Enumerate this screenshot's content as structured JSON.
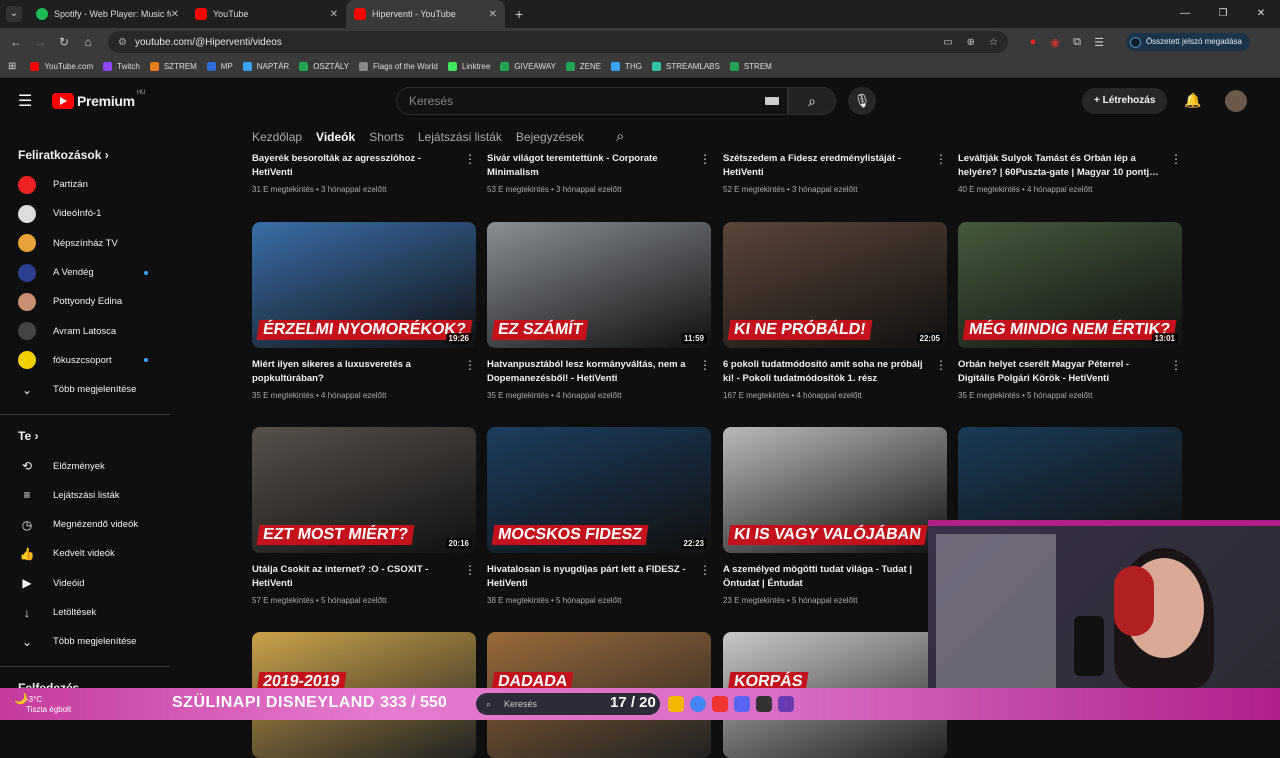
{
  "browser": {
    "tabs": [
      {
        "title": "Spotify - Web Player: Music for",
        "color": "#1db954"
      },
      {
        "title": "YouTube",
        "color": "#ff0000"
      },
      {
        "title": "Hiperventi - YouTube",
        "color": "#ff0000"
      }
    ],
    "url": "youtube.com/@Hiperventi/videos",
    "profile_label": "Összetett jelszó megadása",
    "bookmarks": [
      {
        "label": "YouTube.com",
        "color": "#ff0000"
      },
      {
        "label": "Twitch",
        "color": "#9146ff"
      },
      {
        "label": "SZTREM",
        "color": "#e87a1f"
      },
      {
        "label": "MP",
        "color": "#2e6bd8"
      },
      {
        "label": "NAPTÁR",
        "color": "#3aa4ff"
      },
      {
        "label": "OSZTÁLY",
        "color": "#23a455"
      },
      {
        "label": "Flags of the World",
        "color": "#888888"
      },
      {
        "label": "Linktree",
        "color": "#43e55e"
      },
      {
        "label": "GIVEAWAY",
        "color": "#23a455"
      },
      {
        "label": "ZENE",
        "color": "#23a455"
      },
      {
        "label": "THG",
        "color": "#3aa4ff"
      },
      {
        "label": "STREAMLABS",
        "color": "#31c3a2"
      },
      {
        "label": "STREM",
        "color": "#23a455"
      }
    ]
  },
  "masthead": {
    "logo": "Premium",
    "region": "HU",
    "search_placeholder": "Keresés",
    "create_label": "Létrehozás"
  },
  "sidebar": {
    "subs_heading": "Feliratkozások",
    "subs": [
      {
        "label": "Partizán",
        "color": "#e22",
        "dot": false
      },
      {
        "label": "VideóInfó-1",
        "color": "#ddd",
        "dot": false
      },
      {
        "label": "Népszínház TV",
        "color": "#e8a23a",
        "dot": false
      },
      {
        "label": "A Vendég",
        "color": "#2d3f8f",
        "dot": true
      },
      {
        "label": "Pottyondy Edina",
        "color": "#c98f72",
        "dot": false
      },
      {
        "label": "Avram Latosca",
        "color": "#444",
        "dot": false
      },
      {
        "label": "fókuszcsoport",
        "color": "#f5d000",
        "dot": true
      },
      {
        "label": "Több megjelenítése",
        "color": "transparent",
        "dot": false
      }
    ],
    "you_heading": "Te",
    "you": [
      {
        "label": "Előzmények",
        "icon": "⟲"
      },
      {
        "label": "Lejátszási listák",
        "icon": "≡"
      },
      {
        "label": "Megnézendő videók",
        "icon": "◷"
      },
      {
        "label": "Kedvelt videók",
        "icon": "👍"
      },
      {
        "label": "Videóid",
        "icon": "▶"
      },
      {
        "label": "Letöltések",
        "icon": "↓"
      },
      {
        "label": "Több megjelenítése",
        "icon": "⌄"
      }
    ],
    "explore_heading": "Felfedezés"
  },
  "channel_tabs": [
    "Kezdőlap",
    "Videók",
    "Shorts",
    "Lejátszási listák",
    "Bejegyzések"
  ],
  "videos_top": [
    {
      "title": "Bayerék besorolták az agresszióhoz - HetiVenti",
      "meta": "31 E megtekintés • 3 hónappal ezelőtt"
    },
    {
      "title": "Sivár világot teremtettünk - Corporate Minimalism",
      "meta": "53 E megtekintés • 3 hónappal ezelőtt"
    },
    {
      "title": "Szétszedem a Fidesz eredménylistáját - HetiVenti",
      "meta": "52 E megtekintés • 3 hónappal ezelőtt"
    },
    {
      "title": "Leváltják Sulyok Tamást és Orbán lép a helyére? | 60Puszta-gate | Magyar 10 pontj…",
      "meta": "40 E megtekintés • 4 hónappal ezelőtt"
    }
  ],
  "videos": [
    {
      "title": "Miért ilyen sikeres a luxusveretés a popkultúrában?",
      "meta": "35 E megtekintés • 4 hónappal ezelőtt",
      "caption": "ÉRZELMI NYOMORÉKOK?",
      "duration": "19:26",
      "bg": "#3a6ea8"
    },
    {
      "title": "Hatvanpusztából lesz kormányváltás, nem a Dopemanezésből! - HetiVenti",
      "meta": "35 E megtekintés • 4 hónappal ezelőtt",
      "caption": "EZ SZÁMÍT",
      "duration": "11:59",
      "bg": "#8a8f94"
    },
    {
      "title": "6 pokoli tudatmódosító amit soha ne próbálj ki! - Pokoli tudatmódosítók 1. rész",
      "meta": "167 E megtekintés • 4 hónappal ezelőtt",
      "caption": "KI NE PRÓBÁLD!",
      "duration": "22:05",
      "bg": "#5b4538"
    },
    {
      "title": "Orbán helyet cserélt Magyar Péterrel - Digitális Polgári Körök - HetiVenti",
      "meta": "35 E megtekintés • 5 hónappal ezelőtt",
      "caption": "MÉG MINDIG NEM ÉRTIK?",
      "duration": "13:01",
      "bg": "#445a3c"
    },
    {
      "title": "Utálja Csokit az internet? :O - CSOXIT - HetiVenti",
      "meta": "57 E megtekintés • 5 hónappal ezelőtt",
      "caption": "EZT MOST MIÉRT?",
      "duration": "20:16",
      "bg": "#55504a"
    },
    {
      "title": "Hivatalosan is nyugdíjas párt lett a FIDESZ - HetiVenti",
      "meta": "38 E megtekintés • 5 hónappal ezelőtt",
      "caption": "MOCSKOS FIDESZ",
      "duration": "22:23",
      "bg": "#1d3d5e"
    },
    {
      "title": "A személyed mögötti tudat világa - Tudat | Öntudat | Éntudat",
      "meta": "23 E megtekintés • 5 hónappal ezelőtt",
      "caption": "KI IS VAGY VALÓJÁBAN",
      "duration": "",
      "bg": "#b9b9b9"
    },
    {
      "title": "",
      "meta": "",
      "caption": "",
      "duration": "",
      "bg": "#1a3a55"
    }
  ],
  "videos_bottom": [
    {
      "caption": "2019-2019",
      "bg": "#c9a14a"
    },
    {
      "caption": "DADADA",
      "bg": "#9a6a3a"
    },
    {
      "caption": "KORPÁS",
      "bg": "#c8c8c8"
    }
  ],
  "taskbar": {
    "temperature": "-3°C",
    "weather": "Tiszta égbolt",
    "ticker": "SZÜLINAPI DISNEYLAND",
    "counter": "333 / 550",
    "search": "Keresés",
    "count2": "17 / 20"
  }
}
